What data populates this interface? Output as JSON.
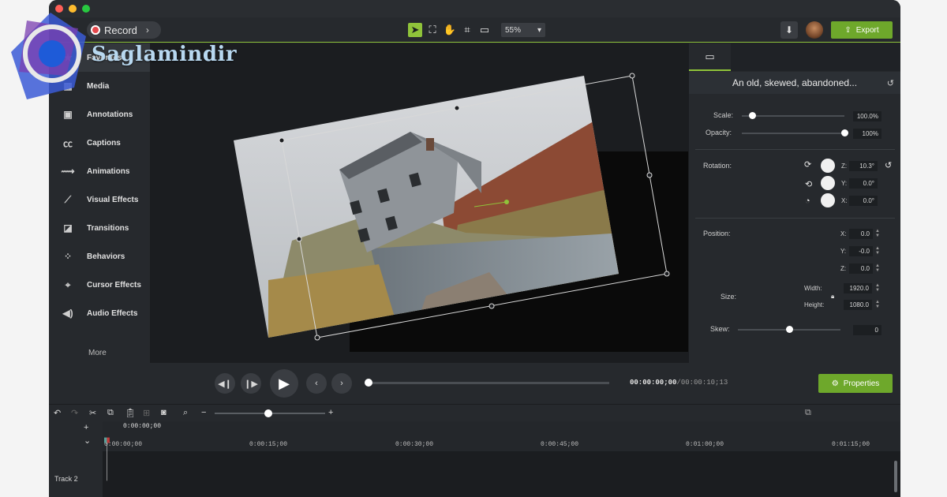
{
  "toolbar": {
    "record_label": "Record",
    "zoom_value": "55%",
    "export_label": "Export"
  },
  "sidebar": {
    "items": [
      {
        "label": "Favorites",
        "icon": "star-icon"
      },
      {
        "label": "Media",
        "icon": "media-icon"
      },
      {
        "label": "Annotations",
        "icon": "annotation-icon"
      },
      {
        "label": "Captions",
        "icon": "captions-icon"
      },
      {
        "label": "Animations",
        "icon": "animation-icon"
      },
      {
        "label": "Visual Effects",
        "icon": "wand-icon"
      },
      {
        "label": "Transitions",
        "icon": "transition-icon"
      },
      {
        "label": "Behaviors",
        "icon": "behaviors-icon"
      },
      {
        "label": "Cursor Effects",
        "icon": "cursor-icon"
      },
      {
        "label": "Audio Effects",
        "icon": "speaker-icon"
      }
    ],
    "more_label": "More"
  },
  "properties": {
    "clip_title": "An old, skewed, abandoned...",
    "scale_label": "Scale:",
    "scale_value": "100.0%",
    "scale_level": 0.1,
    "opacity_label": "Opacity:",
    "opacity_value": "100%",
    "opacity_level": 1.0,
    "rotation_label": "Rotation:",
    "rotation": {
      "z_label": "Z:",
      "z_value": "10.3°",
      "y_label": "Y:",
      "y_value": "0.0°",
      "x_label": "X:",
      "x_value": "0.0°"
    },
    "position_label": "Position:",
    "position": {
      "x_label": "X:",
      "x_value": "0.0",
      "y_label": "Y:",
      "y_value": "-0.0",
      "z_label": "Z:",
      "z_value": "0.0"
    },
    "size_label": "Size:",
    "width_label": "Width:",
    "width_value": "1920.0",
    "height_label": "Height:",
    "height_value": "1080.0",
    "skew_label": "Skew:",
    "skew_value": "0",
    "skew_level": 0.5
  },
  "playback": {
    "time_current": "00:00:00;00",
    "time_total": "00:00:10;13",
    "properties_label": "Properties"
  },
  "timeline": {
    "playhead_time": "0:00:00;00",
    "ticks": [
      "0:00:00;00",
      "0:00:15;00",
      "0:00:30;00",
      "0:00:45;00",
      "0:01:00;00",
      "0:01:15;00"
    ],
    "track_label": "Track 2"
  },
  "watermark": {
    "text": "Saglamindir"
  },
  "colors": {
    "accent": "#8fc33a",
    "export_bg": "#6ea82b",
    "record": "#e5484d"
  }
}
